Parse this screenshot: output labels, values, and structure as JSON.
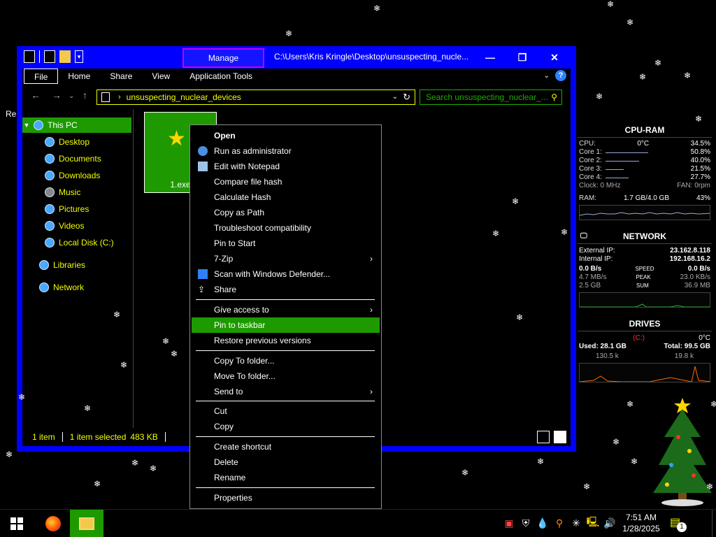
{
  "desktop": {
    "recycle_label": "Re"
  },
  "window": {
    "manage_tab": "Manage",
    "title": "C:\\Users\\Kris Kringle\\Desktop\\unsuspecting_nuclear_devices",
    "title_display": "C:\\Users\\Kris Kringle\\Desktop\\unsuspecting_nucle...",
    "ribbon_tabs": [
      "File",
      "Home",
      "Share",
      "View",
      "Application Tools"
    ],
    "address_path": "unsuspecting_nuclear_devices",
    "search_placeholder": "Search unsuspecting_nuclear_..."
  },
  "navpane": {
    "this_pc": "This PC",
    "desktop": "Desktop",
    "documents": "Documents",
    "downloads": "Downloads",
    "music": "Music",
    "pictures": "Pictures",
    "videos": "Videos",
    "local_disk": "Local Disk (C:)",
    "libraries": "Libraries",
    "network": "Network"
  },
  "file": {
    "name": "1.exe"
  },
  "status": {
    "count": "1 item",
    "selected": "1 item selected",
    "size": "483 KB"
  },
  "context_menu": {
    "open": "Open",
    "run_admin": "Run as administrator",
    "edit_notepad": "Edit with Notepad",
    "compare_hash": "Compare file hash",
    "calc_hash": "Calculate Hash",
    "copy_path": "Copy as Path",
    "troubleshoot": "Troubleshoot compatibility",
    "pin_start": "Pin to Start",
    "zip": "7-Zip",
    "defender": "Scan with Windows Defender...",
    "share": "Share",
    "give_access": "Give access to",
    "pin_taskbar": "Pin to taskbar",
    "restore": "Restore previous versions",
    "copy_to": "Copy To folder...",
    "move_to": "Move To folder...",
    "send_to": "Send to",
    "cut": "Cut",
    "copy": "Copy",
    "create_shortcut": "Create shortcut",
    "delete": "Delete",
    "rename": "Rename",
    "properties": "Properties"
  },
  "cpu_ram": {
    "title": "CPU-RAM",
    "cpu_label": "CPU:",
    "cpu_temp": "0°C",
    "cpu_pct": "34.5%",
    "cores": [
      {
        "label": "Core 1:",
        "pct": "50.8%",
        "value": 50.8
      },
      {
        "label": "Core 2:",
        "pct": "40.0%",
        "value": 40.0
      },
      {
        "label": "Core 3:",
        "pct": "21.5%",
        "value": 21.5
      },
      {
        "label": "Core 4:",
        "pct": "27.7%",
        "value": 27.7
      }
    ],
    "clock": "Clock: 0 MHz",
    "fan": "FAN: 0rpm",
    "ram_label": "RAM:",
    "ram_value": "1.7 GB/4.0 GB",
    "ram_pct": "43%"
  },
  "network": {
    "title": "NETWORK",
    "external_label": "External IP:",
    "external_ip": "23.162.8.118",
    "internal_label": "Internal IP:",
    "internal_ip": "192.168.16.2",
    "speed_down": "0.0 B/s",
    "speed_label": "SPEED",
    "speed_up": "0.0 B/s",
    "peak_down": "4.7 MB/s",
    "peak_label": "PEAK",
    "peak_up": "23.0 KB/s",
    "sum_down": "2.5 GB",
    "sum_label": "SUM",
    "sum_up": "36.9 MB"
  },
  "drives": {
    "title": "DRIVES",
    "drive": "(C:)",
    "temp": "0°C",
    "used": "Used: 28.1 GB",
    "total": "Total: 99.5 GB",
    "read": "130.5 k",
    "write": "19.8 k"
  },
  "taskbar": {
    "time": "7:51 AM",
    "date": "1/28/2025",
    "notifications": "1"
  },
  "colors": {
    "accent_green": "#1e9a00",
    "title_blue": "#0000ff",
    "text_yellow": "#f2ff00"
  }
}
